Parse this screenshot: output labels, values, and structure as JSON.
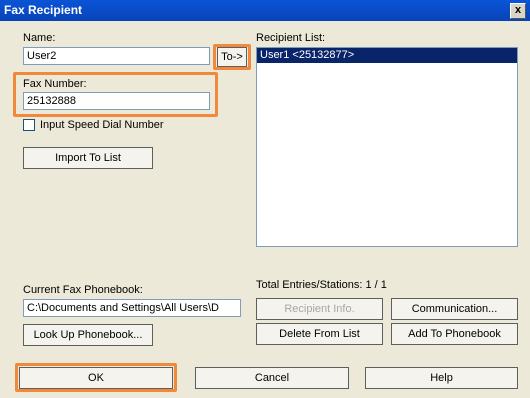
{
  "window": {
    "title": "Fax Recipient",
    "close_glyph": "x"
  },
  "left": {
    "name_label": "Name:",
    "name_value": "User2",
    "to_button": "To->",
    "fax_label": "Fax Number:",
    "fax_value": "25132888",
    "speed_dial_label": "Input Speed Dial Number",
    "speed_dial_checked": false,
    "import_button": "Import To List",
    "phonebook_label": "Current Fax Phonebook:",
    "phonebook_value": "C:\\Documents and Settings\\All Users\\D",
    "lookup_button": "Look Up Phonebook..."
  },
  "right": {
    "recipient_label": "Recipient List:",
    "recipients": [
      "User1 <25132877>"
    ],
    "total_label": "Total Entries/Stations: 1 / 1",
    "recipient_info_button": "Recipient Info.",
    "communication_button": "Communication...",
    "delete_button": "Delete From List",
    "add_button": "Add To Phonebook"
  },
  "footer": {
    "ok_button": "OK",
    "cancel_button": "Cancel",
    "help_button": "Help"
  },
  "colors": {
    "highlight": "#f0893b",
    "title_bar": "#0a54d6",
    "selection": "#0a246a"
  }
}
